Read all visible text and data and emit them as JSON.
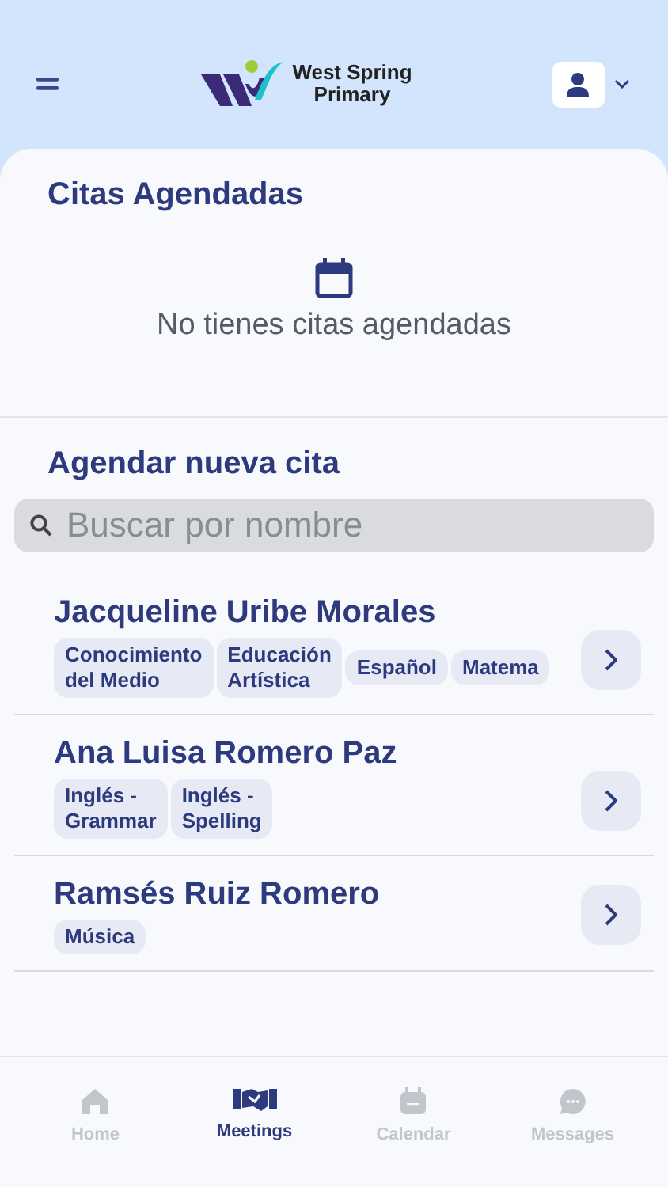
{
  "header": {
    "brand_line_1": "West Spring",
    "brand_line_2": "Primary"
  },
  "appointments": {
    "title": "Citas Agendadas",
    "empty_message": "No tienes citas agendadas"
  },
  "new_appointment": {
    "title": "Agendar nueva cita",
    "search": {
      "placeholder": "Buscar por nombre"
    }
  },
  "teachers": [
    {
      "name": "Jacqueline Uribe Morales",
      "subjects": [
        "Conocimiento\ndel Medio",
        "Educación\nArtística",
        "Español",
        "Matema"
      ]
    },
    {
      "name": "Ana Luisa Romero Paz",
      "subjects": [
        "Inglés -\nGrammar",
        "Inglés -\nSpelling"
      ]
    },
    {
      "name": "Ramsés Ruiz Romero",
      "subjects": [
        "Música"
      ]
    }
  ],
  "tabs": [
    {
      "label": "Home",
      "selected": false
    },
    {
      "label": "Meetings",
      "selected": true
    },
    {
      "label": "Calendar",
      "selected": false
    },
    {
      "label": "Messages",
      "selected": false
    }
  ]
}
